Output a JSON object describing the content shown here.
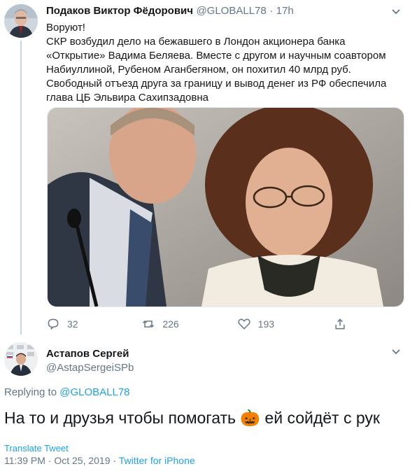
{
  "tweet1": {
    "author_name": "Подаков Виктор Фёдорович",
    "author_handle": "@GLOBALL78",
    "time_sep": "·",
    "time": "17h",
    "text": "Воруют!\nСКР возбудил дело на бежавшего в Лондон акционера банка «Открытие» Вадима Беляева. Вместе с другом и научным соавтором Набиуллиной, Рубеном Аганбегяном, он похитил 40 млрд руб. Свободный отъезд друга за границу и вывод денег из РФ обеспечила глава ЦБ Эльвира Сахипзадовна",
    "actions": {
      "replies": "32",
      "retweets": "226",
      "likes": "193"
    }
  },
  "tweet2": {
    "author_name": "Астапов Сергей",
    "author_handle": "@AstapSergeiSPb",
    "replying_prefix": "Replying to",
    "replying_to": "@GLOBALL78",
    "text_before": "На то и друзья чтобы помогать",
    "emoji": "🎃",
    "text_after": "ей сойдёт с рук",
    "translate": "Translate Tweet",
    "timestamp": "11:39 PM · Oct 25, 2019",
    "meta_sep": "·",
    "source": "Twitter for iPhone"
  },
  "colors": {
    "link": "#1da1f2",
    "muted": "#657786",
    "divider": "#e6ecf0"
  }
}
